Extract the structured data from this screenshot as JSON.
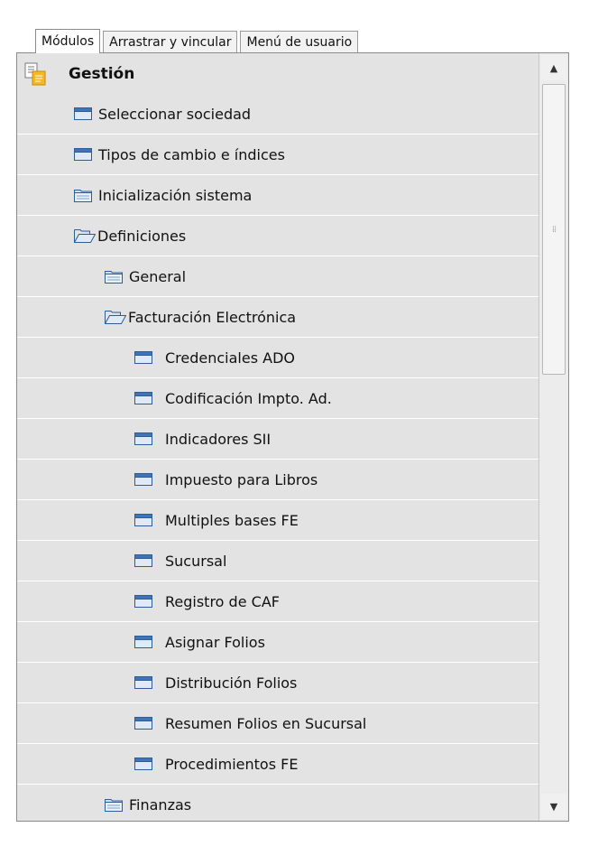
{
  "tabs": {
    "modulos": "Módulos",
    "arrastrar": "Arrastrar y vincular",
    "menu_usuario": "Menú de usuario"
  },
  "tree": {
    "root": "Gestión",
    "items": [
      "Seleccionar sociedad",
      "Tipos de cambio e índices",
      "Inicialización sistema",
      "Definiciones",
      "General",
      "Facturación Electrónica",
      "Credenciales ADO",
      "Codificación Impto. Ad.",
      "Indicadores SII",
      "Impuesto para Libros",
      "Multiples bases FE",
      "Sucursal",
      "Registro de CAF",
      "Asignar Folios",
      "Distribución Folios",
      "Resumen Folios en Sucursal",
      "Procedimientos FE",
      "Finanzas"
    ]
  },
  "icons": {
    "root": "module-icon",
    "window": "window-icon",
    "folder_closed": "folder-icon",
    "folder_open": "folder-open-icon"
  },
  "colors": {
    "panel_bg": "#e3e3e3",
    "row_separator": "#ffffff",
    "window_icon_fill": "#3f74b7",
    "folder_icon_stroke": "#2e5c97"
  }
}
